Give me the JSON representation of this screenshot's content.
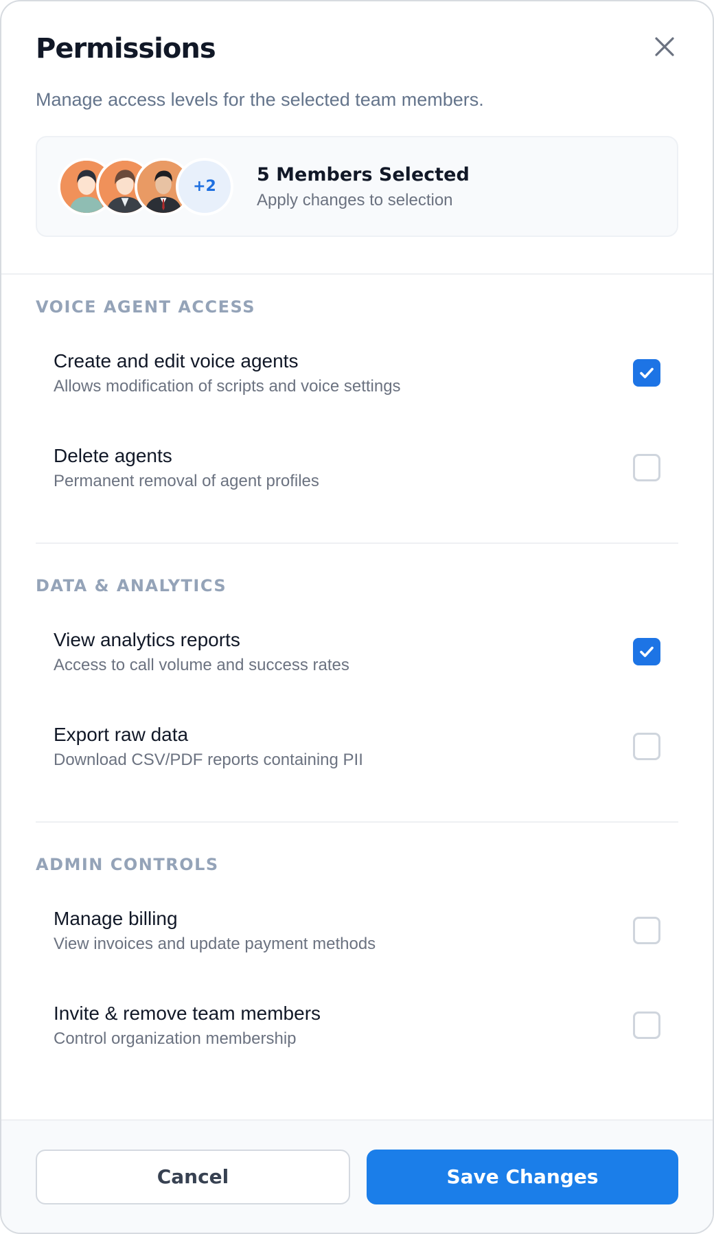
{
  "header": {
    "title": "Permissions",
    "subtitle": "Manage access levels for the selected team members."
  },
  "members": {
    "more_count": "+2",
    "title": "5 Members Selected",
    "subtitle": "Apply changes to selection"
  },
  "sections": [
    {
      "title": "VOICE AGENT ACCESS",
      "items": [
        {
          "label": "Create and edit voice agents",
          "description": "Allows modification of scripts and voice settings",
          "checked": true
        },
        {
          "label": "Delete agents",
          "description": "Permanent removal of agent profiles",
          "checked": false
        }
      ]
    },
    {
      "title": "DATA & ANALYTICS",
      "items": [
        {
          "label": "View analytics reports",
          "description": "Access to call volume and success rates",
          "checked": true
        },
        {
          "label": "Export raw data",
          "description": "Download CSV/PDF reports containing PII",
          "checked": false
        }
      ]
    },
    {
      "title": "ADMIN CONTROLS",
      "items": [
        {
          "label": "Manage billing",
          "description": "View invoices and update payment methods",
          "checked": false
        },
        {
          "label": "Invite & remove team members",
          "description": "Control organization membership",
          "checked": false
        }
      ]
    }
  ],
  "footer": {
    "cancel_label": "Cancel",
    "save_label": "Save Changes"
  },
  "colors": {
    "accent": "#1b7ee9",
    "checkbox_checked": "#1d74e5",
    "section_title": "#94a3b8"
  },
  "icons": {
    "close": "close-icon",
    "check": "check-icon",
    "avatar": "user-avatar"
  }
}
